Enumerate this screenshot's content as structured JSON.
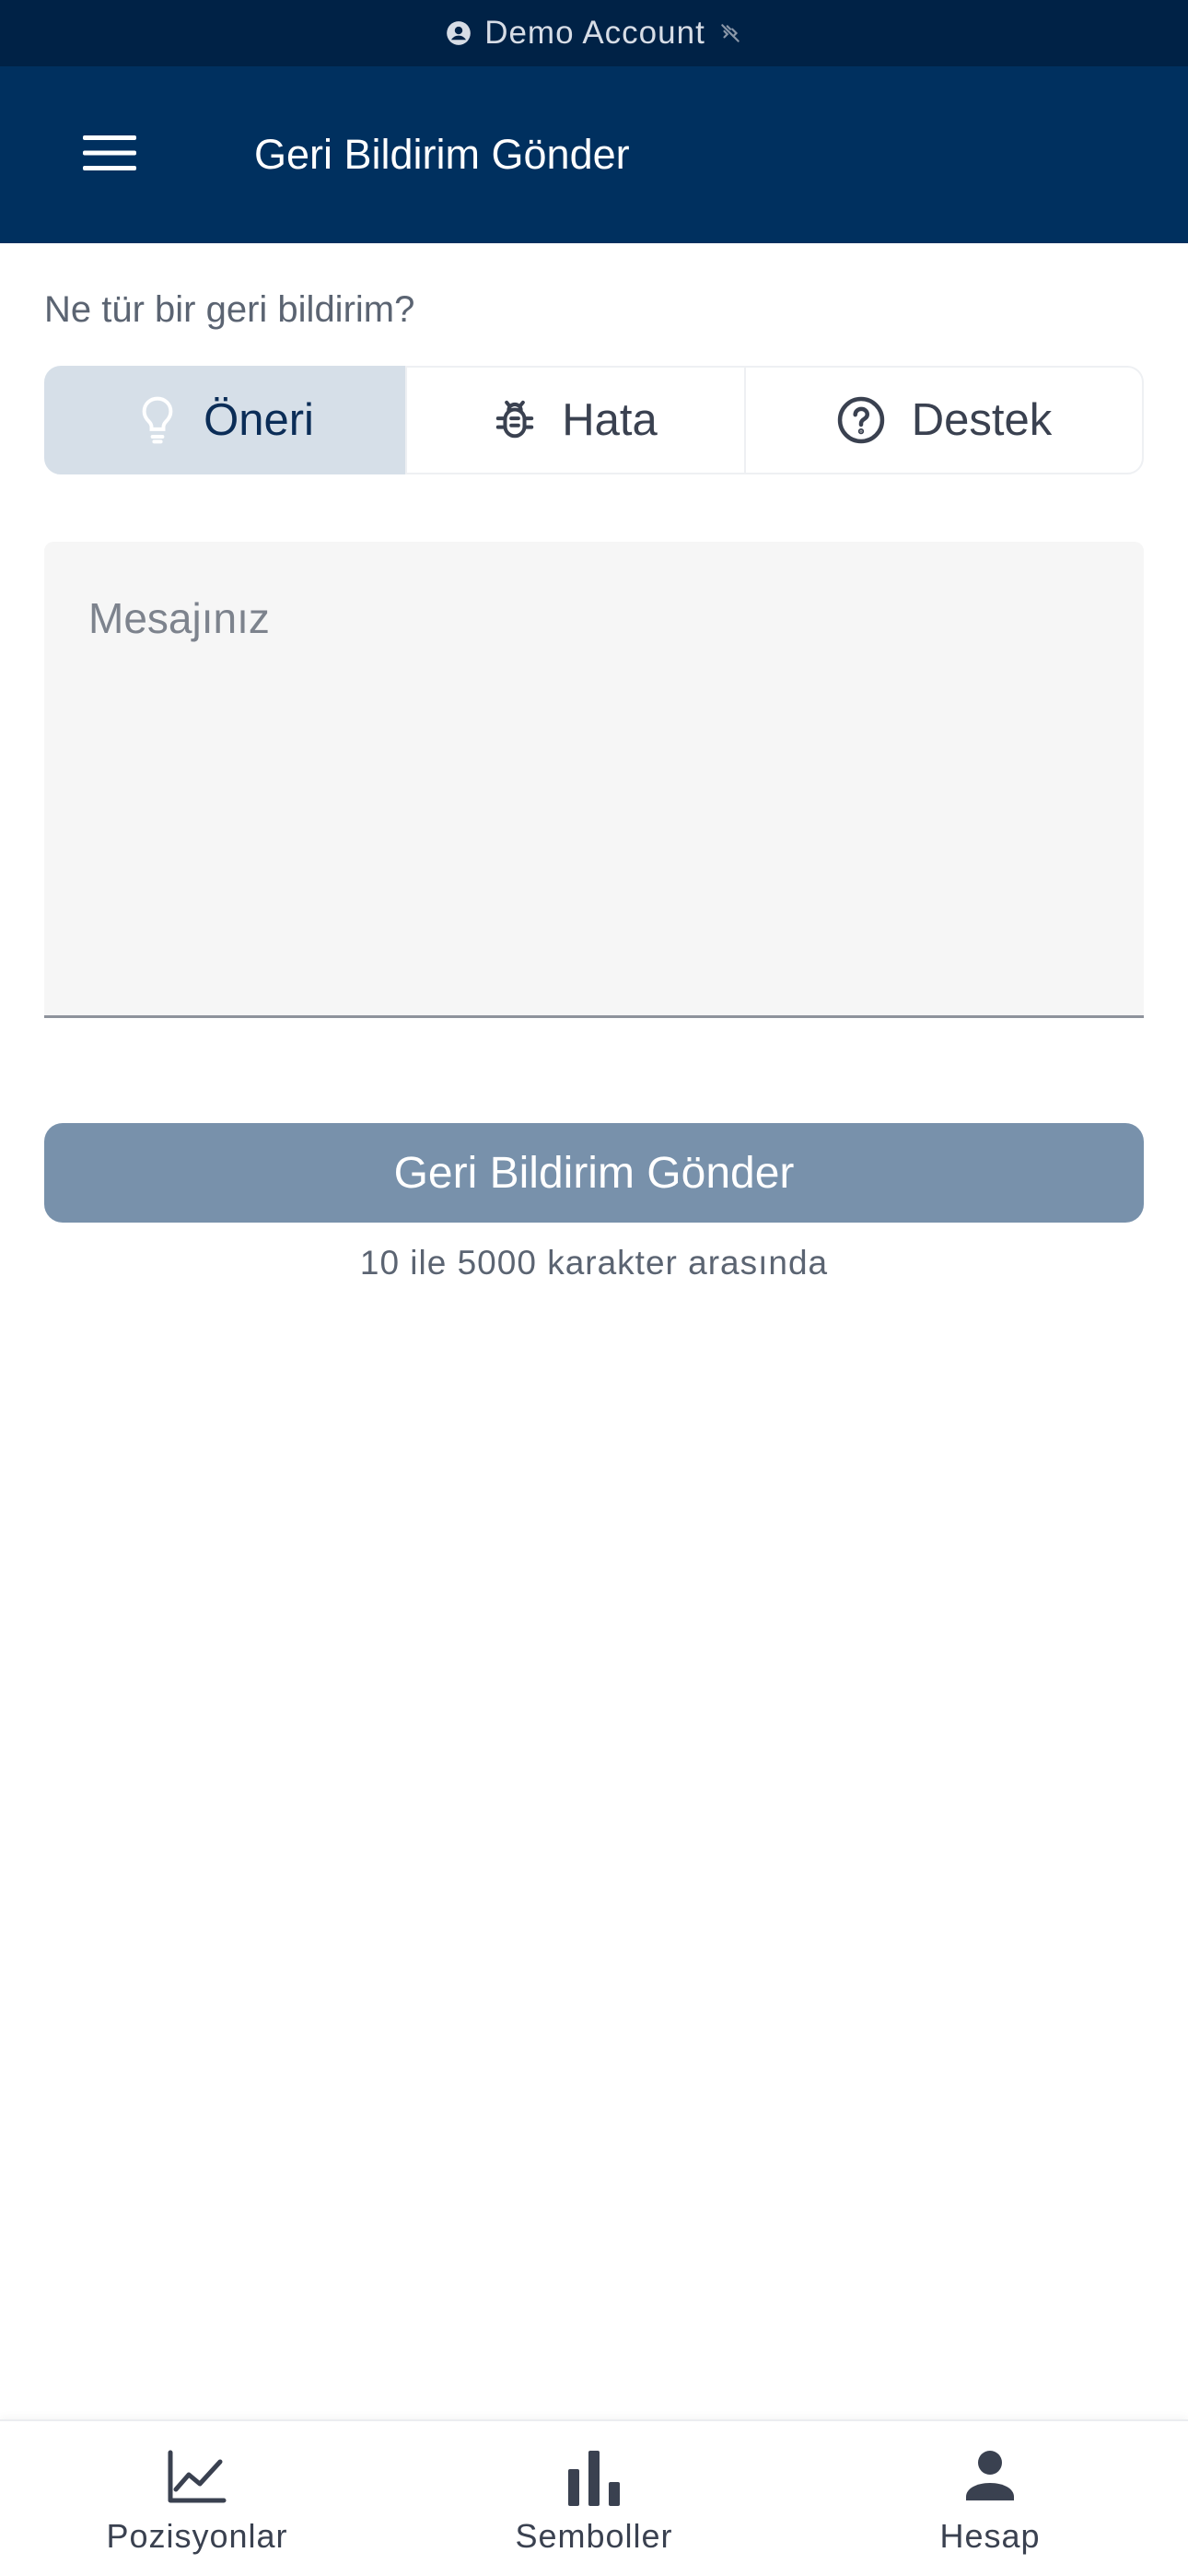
{
  "banner": {
    "text": "Demo Account",
    "left_icon": "account-circle-icon",
    "right_icon": "link-off-icon"
  },
  "header": {
    "title": "Geri Bildirim Gönder",
    "menu_icon": "hamburger-menu-icon"
  },
  "feedback": {
    "question": "Ne tür bir geri bildirim?",
    "types": [
      {
        "label": "Öneri",
        "icon": "lightbulb-icon",
        "selected": true
      },
      {
        "label": "Hata",
        "icon": "bug-icon",
        "selected": false
      },
      {
        "label": "Destek",
        "icon": "help-circle-icon",
        "selected": false
      }
    ],
    "message_placeholder": "Mesajınız",
    "message_value": "",
    "submit_label": "Geri Bildirim Gönder",
    "hint": "10 ile 5000 karakter arasında"
  },
  "bottom_nav": {
    "items": [
      {
        "label": "Pozisyonlar",
        "icon": "chart-line-icon"
      },
      {
        "label": "Semboller",
        "icon": "bar-chart-icon"
      },
      {
        "label": "Hesap",
        "icon": "person-icon"
      }
    ]
  },
  "colors": {
    "banner_bg": "#002246",
    "header_bg": "#00305f",
    "selected_segment_bg": "#d6dfe8",
    "submit_button_bg": "#7891ab",
    "field_bg": "#f6f6f6"
  }
}
